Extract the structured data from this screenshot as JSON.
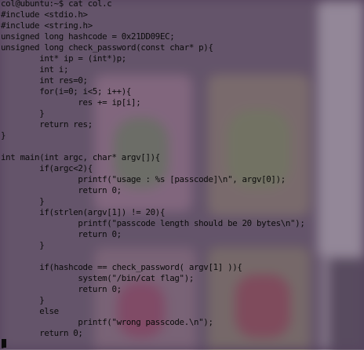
{
  "terminal": {
    "prompt_line": "col@ubuntu:~$ cat col.c",
    "lines": [
      "#include <stdio.h>",
      "#include <string.h>",
      "unsigned long hashcode = 0x21DD09EC;",
      "unsigned long check_password(const char* p){",
      "        int* ip = (int*)p;",
      "        int i;",
      "        int res=0;",
      "        for(i=0; i<5; i++){",
      "                res += ip[i];",
      "        }",
      "        return res;",
      "}",
      "",
      "int main(int argc, char* argv[]){",
      "        if(argc<2){",
      "                printf(\"usage : %s [passcode]\\n\", argv[0]);",
      "                return 0;",
      "        }",
      "        if(strlen(argv[1]) != 20){",
      "                printf(\"passcode length should be 20 bytes\\n\");",
      "                return 0;",
      "        }",
      "",
      "        if(hashcode == check_password( argv[1] )){",
      "                system(\"/bin/cat flag\");",
      "                return 0;",
      "        }",
      "        else",
      "                printf(\"wrong passcode.\\n\");",
      "        return 0;",
      "}"
    ]
  }
}
